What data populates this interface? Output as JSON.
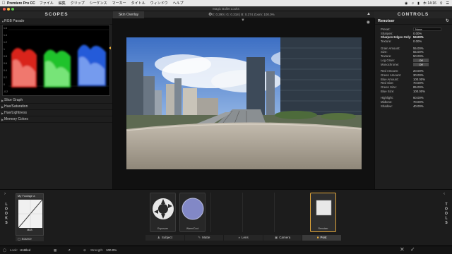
{
  "menubar": {
    "app_name": "Premiere Pro CC",
    "items": [
      "ファイル",
      "編集",
      "クリップ",
      "シーケンス",
      "マーカー",
      "タイトル",
      "ウィンドウ",
      "ヘルプ"
    ],
    "clock": "木 14:16"
  },
  "window": {
    "title": "Magic Bullet Looks"
  },
  "scopes": {
    "header": "SCOPES",
    "sections": [
      "RGB Parade",
      "Slice Graph",
      "Hue/Saturation",
      "Hue/Lightness",
      "Memory Colors"
    ],
    "axis_ticks": [
      "1.6",
      "1.4",
      "1.2",
      "1",
      "0.8",
      "0.6",
      "0.4",
      "0.2",
      "0",
      "-0.2"
    ],
    "colors": {
      "red": "#ff2a1e",
      "green": "#27e531",
      "blue": "#2a6bff"
    }
  },
  "toolbar": {
    "tab_label": "Skin Overlay",
    "readout": "X: 0.290 | G: 0.318 | B: 0.374    Zoom: 100.0%"
  },
  "controls": {
    "header": "CONTROLS",
    "tool_name": "Renoiser",
    "preset": {
      "label": "Preset:",
      "value": "None"
    },
    "rows_a": [
      {
        "label": "Sharpen:",
        "value": "0.00%"
      },
      {
        "label": "Sharpen Edges Only:",
        "value": "53.00%"
      },
      {
        "label": "Texture:",
        "value": "0.00%"
      }
    ],
    "rows_b": [
      {
        "label": "Grain Amount:",
        "value": "55.00%"
      },
      {
        "label": "Size:",
        "value": "55.00%"
      },
      {
        "label": "Texture:",
        "value": "50.00%"
      }
    ],
    "log_grain": {
      "label": "Log Grain:",
      "value": "Off"
    },
    "monochrome": {
      "label": "Monochrome:",
      "value": "Off"
    },
    "rows_c": [
      {
        "label": "Red Amount:",
        "value": "20.00%"
      },
      {
        "label": "Green Amount:",
        "value": "30.00%"
      },
      {
        "label": "Blue Amount:",
        "value": "100.00%"
      },
      {
        "label": "Red Size:",
        "value": "70.00%"
      },
      {
        "label": "Green Size:",
        "value": "85.00%"
      },
      {
        "label": "Blue Size:",
        "value": "100.00%"
      }
    ],
    "rows_d": [
      {
        "label": "Highlight:",
        "value": "60.00%"
      },
      {
        "label": "Midtone:",
        "value": "70.00%"
      },
      {
        "label": "Shadow:",
        "value": "40.00%"
      }
    ]
  },
  "looks": {
    "vertical_label": "LOOKS",
    "tile_name": "My Footage a",
    "tile_caption": "MLB",
    "source_label": "Source"
  },
  "tools": {
    "vertical_label": "TOOLS",
    "tiles": [
      {
        "caption": "Exposure"
      },
      {
        "caption": "Warm/Cool"
      },
      {
        "caption": "Renoiser"
      }
    ],
    "categories": [
      {
        "label": "Subject",
        "icon": "person-icon"
      },
      {
        "label": "Matte",
        "icon": "matte-icon"
      },
      {
        "label": "Lens",
        "icon": "lens-icon"
      },
      {
        "label": "Camera",
        "icon": "camera-icon"
      },
      {
        "label": "Post",
        "icon": "post-icon",
        "active": true
      }
    ]
  },
  "status": {
    "look_label": "Look:",
    "look_value": "Untitled",
    "strength_label": "Strength:",
    "strength_value": "100.0%"
  }
}
